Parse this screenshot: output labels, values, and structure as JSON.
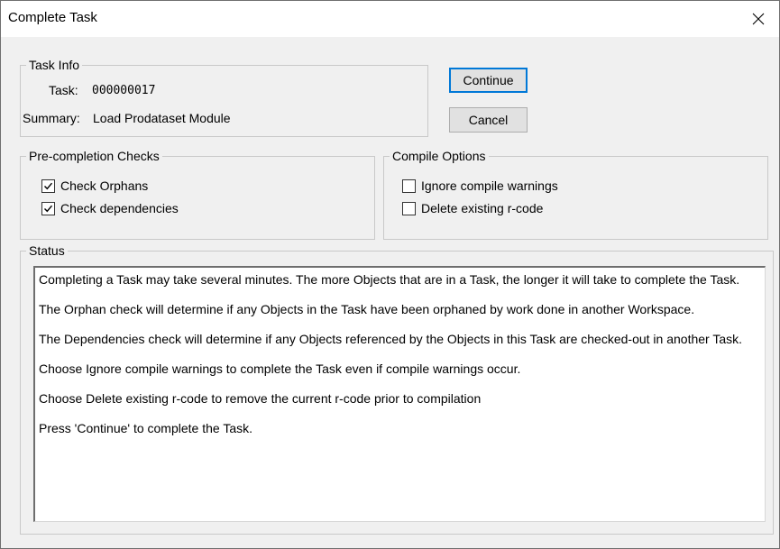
{
  "window": {
    "title": "Complete Task"
  },
  "task_info": {
    "group_label": "Task Info",
    "task_label": "Task:",
    "task_value": "000000017",
    "summary_label": "Summary:",
    "summary_value": "Load Prodataset Module"
  },
  "buttons": {
    "continue_label": "Continue",
    "cancel_label": "Cancel"
  },
  "precompletion": {
    "group_label": "Pre-completion Checks",
    "check_orphans": {
      "label": "Check Orphans",
      "checked": true
    },
    "check_dependencies": {
      "label": "Check dependencies",
      "checked": true
    }
  },
  "compile_options": {
    "group_label": "Compile Options",
    "ignore_warnings": {
      "label": "Ignore compile warnings",
      "checked": false
    },
    "delete_rcode": {
      "label": "Delete existing r-code",
      "checked": false
    }
  },
  "status": {
    "group_label": "Status",
    "lines": [
      "Completing a Task may take several minutes. The more Objects that are in a Task, the longer it will take to complete the Task.",
      "The Orphan check will determine if any Objects in the Task have been orphaned by work done in another Workspace.",
      "The Dependencies check will determine if any Objects referenced by the Objects in this Task are checked-out in another Task.",
      "Choose Ignore compile warnings to complete the Task even if compile warnings occur.",
      "Choose Delete existing r-code to remove the current r-code prior to compilation",
      "Press 'Continue' to complete the Task."
    ]
  }
}
